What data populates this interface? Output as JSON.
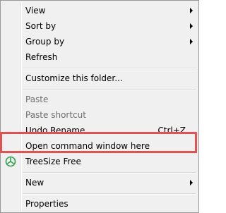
{
  "menu": {
    "items": [
      {
        "label": "View"
      },
      {
        "label": "Sort by"
      },
      {
        "label": "Group by"
      },
      {
        "label": "Refresh"
      },
      {
        "label": "Customize this folder..."
      },
      {
        "label": "Paste"
      },
      {
        "label": "Paste shortcut"
      },
      {
        "label": "Undo Rename",
        "shortcut": "Ctrl+Z"
      },
      {
        "label": "Open command window here"
      },
      {
        "label": "TreeSize Free"
      },
      {
        "label": "New"
      },
      {
        "label": "Properties"
      }
    ]
  },
  "colors": {
    "menu_bg": "#f0f0f0",
    "highlight_border": "#e05352",
    "disabled_text": "#6d6d6d",
    "treesize_icon": "#2e9f4a"
  },
  "icons": {
    "treesize": "treesize-icon",
    "submenu": "submenu-arrow-icon"
  }
}
